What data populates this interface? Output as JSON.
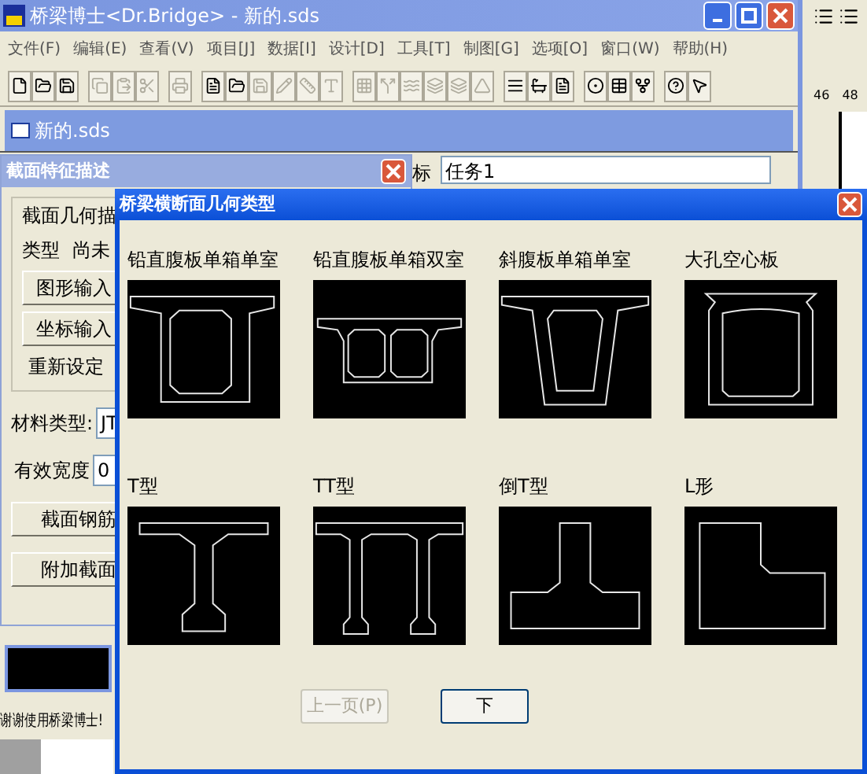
{
  "main_window": {
    "title": "桥梁博士<Dr.Bridge> - 新的.sds"
  },
  "menu": [
    "文件(F)",
    "编辑(E)",
    "查看(V)",
    "项目[J]",
    "数据[I]",
    "设计[D]",
    "工具[T]",
    "制图[G]",
    "选项[O]",
    "窗口(W)",
    "帮助(H)"
  ],
  "toolbar": [
    [
      {
        "kind": "new",
        "disabled": false
      },
      {
        "kind": "open",
        "disabled": false
      },
      {
        "kind": "save",
        "disabled": false
      }
    ],
    [
      {
        "kind": "copy",
        "disabled": true
      },
      {
        "kind": "paste",
        "disabled": true
      },
      {
        "kind": "cut",
        "disabled": true
      }
    ],
    [
      {
        "kind": "print",
        "disabled": true
      }
    ],
    [
      {
        "kind": "page",
        "disabled": false
      },
      {
        "kind": "open",
        "disabled": false
      },
      {
        "kind": "save",
        "disabled": true
      },
      {
        "kind": "pencil",
        "disabled": true
      },
      {
        "kind": "ruler",
        "disabled": true
      },
      {
        "kind": "text",
        "disabled": true
      }
    ],
    [
      {
        "kind": "grid",
        "disabled": true
      },
      {
        "kind": "split",
        "disabled": true
      },
      {
        "kind": "waves",
        "disabled": true
      },
      {
        "kind": "layers",
        "disabled": true
      },
      {
        "kind": "layers",
        "disabled": true
      },
      {
        "kind": "triangle",
        "disabled": true
      }
    ],
    [
      {
        "kind": "lines",
        "disabled": false
      },
      {
        "kind": "bowl",
        "disabled": false
      },
      {
        "kind": "page",
        "disabled": false
      }
    ],
    [
      {
        "kind": "circle",
        "disabled": false
      },
      {
        "kind": "table",
        "disabled": false
      },
      {
        "kind": "fork",
        "disabled": false
      }
    ],
    [
      {
        "kind": "help",
        "disabled": false
      },
      {
        "kind": "pointer",
        "disabled": false
      }
    ]
  ],
  "document_window": {
    "title": "新的.sds"
  },
  "ruler": [
    "46",
    "48"
  ],
  "task_field": {
    "label": "标",
    "value": "任务1"
  },
  "section_dialog": {
    "title": "截面特征描述",
    "group_title": "截面几何描",
    "type_label": "类型",
    "type_value": "尚未",
    "buttons": [
      "图形输入",
      "坐标输入"
    ],
    "reset_text": "重新设定",
    "material_label": "材料类型:",
    "material_value": "JT",
    "width_label": "有效宽度",
    "width_value": "0",
    "bottom_buttons": [
      "截面钢筋",
      "附加截面"
    ]
  },
  "status_text": "谢谢使用桥梁博士!",
  "type_dialog": {
    "title": "桥梁横断面几何类型",
    "types": [
      {
        "label": "铅直腹板单箱单室",
        "kind": "single_box"
      },
      {
        "label": "铅直腹板单箱双室",
        "kind": "double_box"
      },
      {
        "label": "斜腹板单箱单室",
        "kind": "sloped_box"
      },
      {
        "label": "大孔空心板",
        "kind": "hollow_slab"
      },
      {
        "label": "T型",
        "kind": "t"
      },
      {
        "label": "TT型",
        "kind": "tt"
      },
      {
        "label": "倒T型",
        "kind": "inverted_t"
      },
      {
        "label": "L形",
        "kind": "l"
      }
    ],
    "buttons": [
      {
        "label": "上一页(P)",
        "disabled": true
      },
      {
        "label": "下",
        "disabled": false
      }
    ]
  }
}
